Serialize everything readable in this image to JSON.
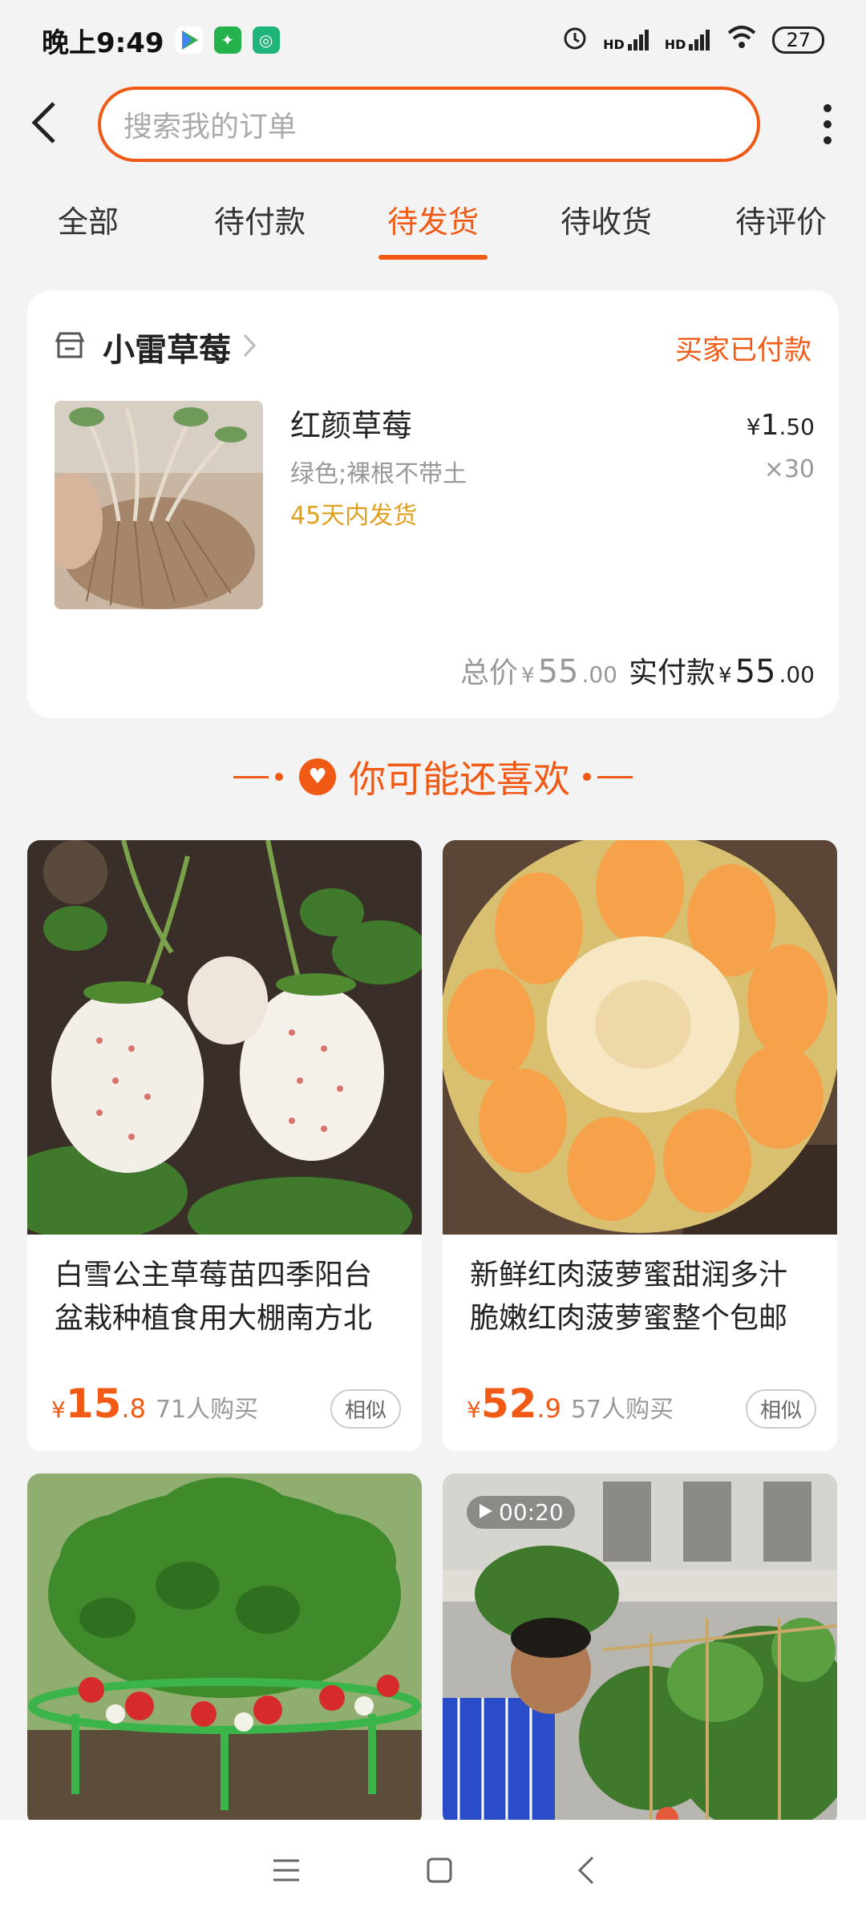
{
  "status_bar": {
    "time": "晚上9:49",
    "battery": "27",
    "signal_labels": [
      "HD",
      "HD"
    ]
  },
  "search": {
    "placeholder": "搜索我的订单"
  },
  "tabs": [
    {
      "label": "全部",
      "active": false
    },
    {
      "label": "待付款",
      "active": false
    },
    {
      "label": "待发货",
      "active": true
    },
    {
      "label": "待收货",
      "active": false
    },
    {
      "label": "待评价",
      "active": false
    }
  ],
  "order": {
    "shop_name": "小雷草莓",
    "status": "买家已付款",
    "product": {
      "title": "红颜草莓",
      "spec": "绿色;裸根不带土",
      "shipping": "45天内发货",
      "price_currency": "¥",
      "price_int": "1",
      "price_dec": ".50",
      "quantity": "×30"
    },
    "total": {
      "label": "总价",
      "currency": "¥",
      "int": "55",
      "dec": ".00"
    },
    "paid": {
      "label": "实付款",
      "currency": "¥",
      "int": "55",
      "dec": ".00"
    }
  },
  "recommend": {
    "heading": "你可能还喜欢",
    "items": [
      {
        "title": "白雪公主草莓苗四季阳台盆栽种植食用大棚南方北",
        "currency": "¥",
        "price_int": "15",
        "price_dec": ".8",
        "buyers": "71人购买",
        "similar": "相似"
      },
      {
        "title": "新鲜红肉菠萝蜜甜润多汁脆嫩红肉菠萝蜜整个包邮",
        "currency": "¥",
        "price_int": "52",
        "price_dec": ".9",
        "buyers": "57人购买",
        "similar": "相似"
      },
      {
        "video_duration": "00:20"
      }
    ]
  },
  "colors": {
    "accent": "#f05a14",
    "shipping": "#e0a020"
  }
}
